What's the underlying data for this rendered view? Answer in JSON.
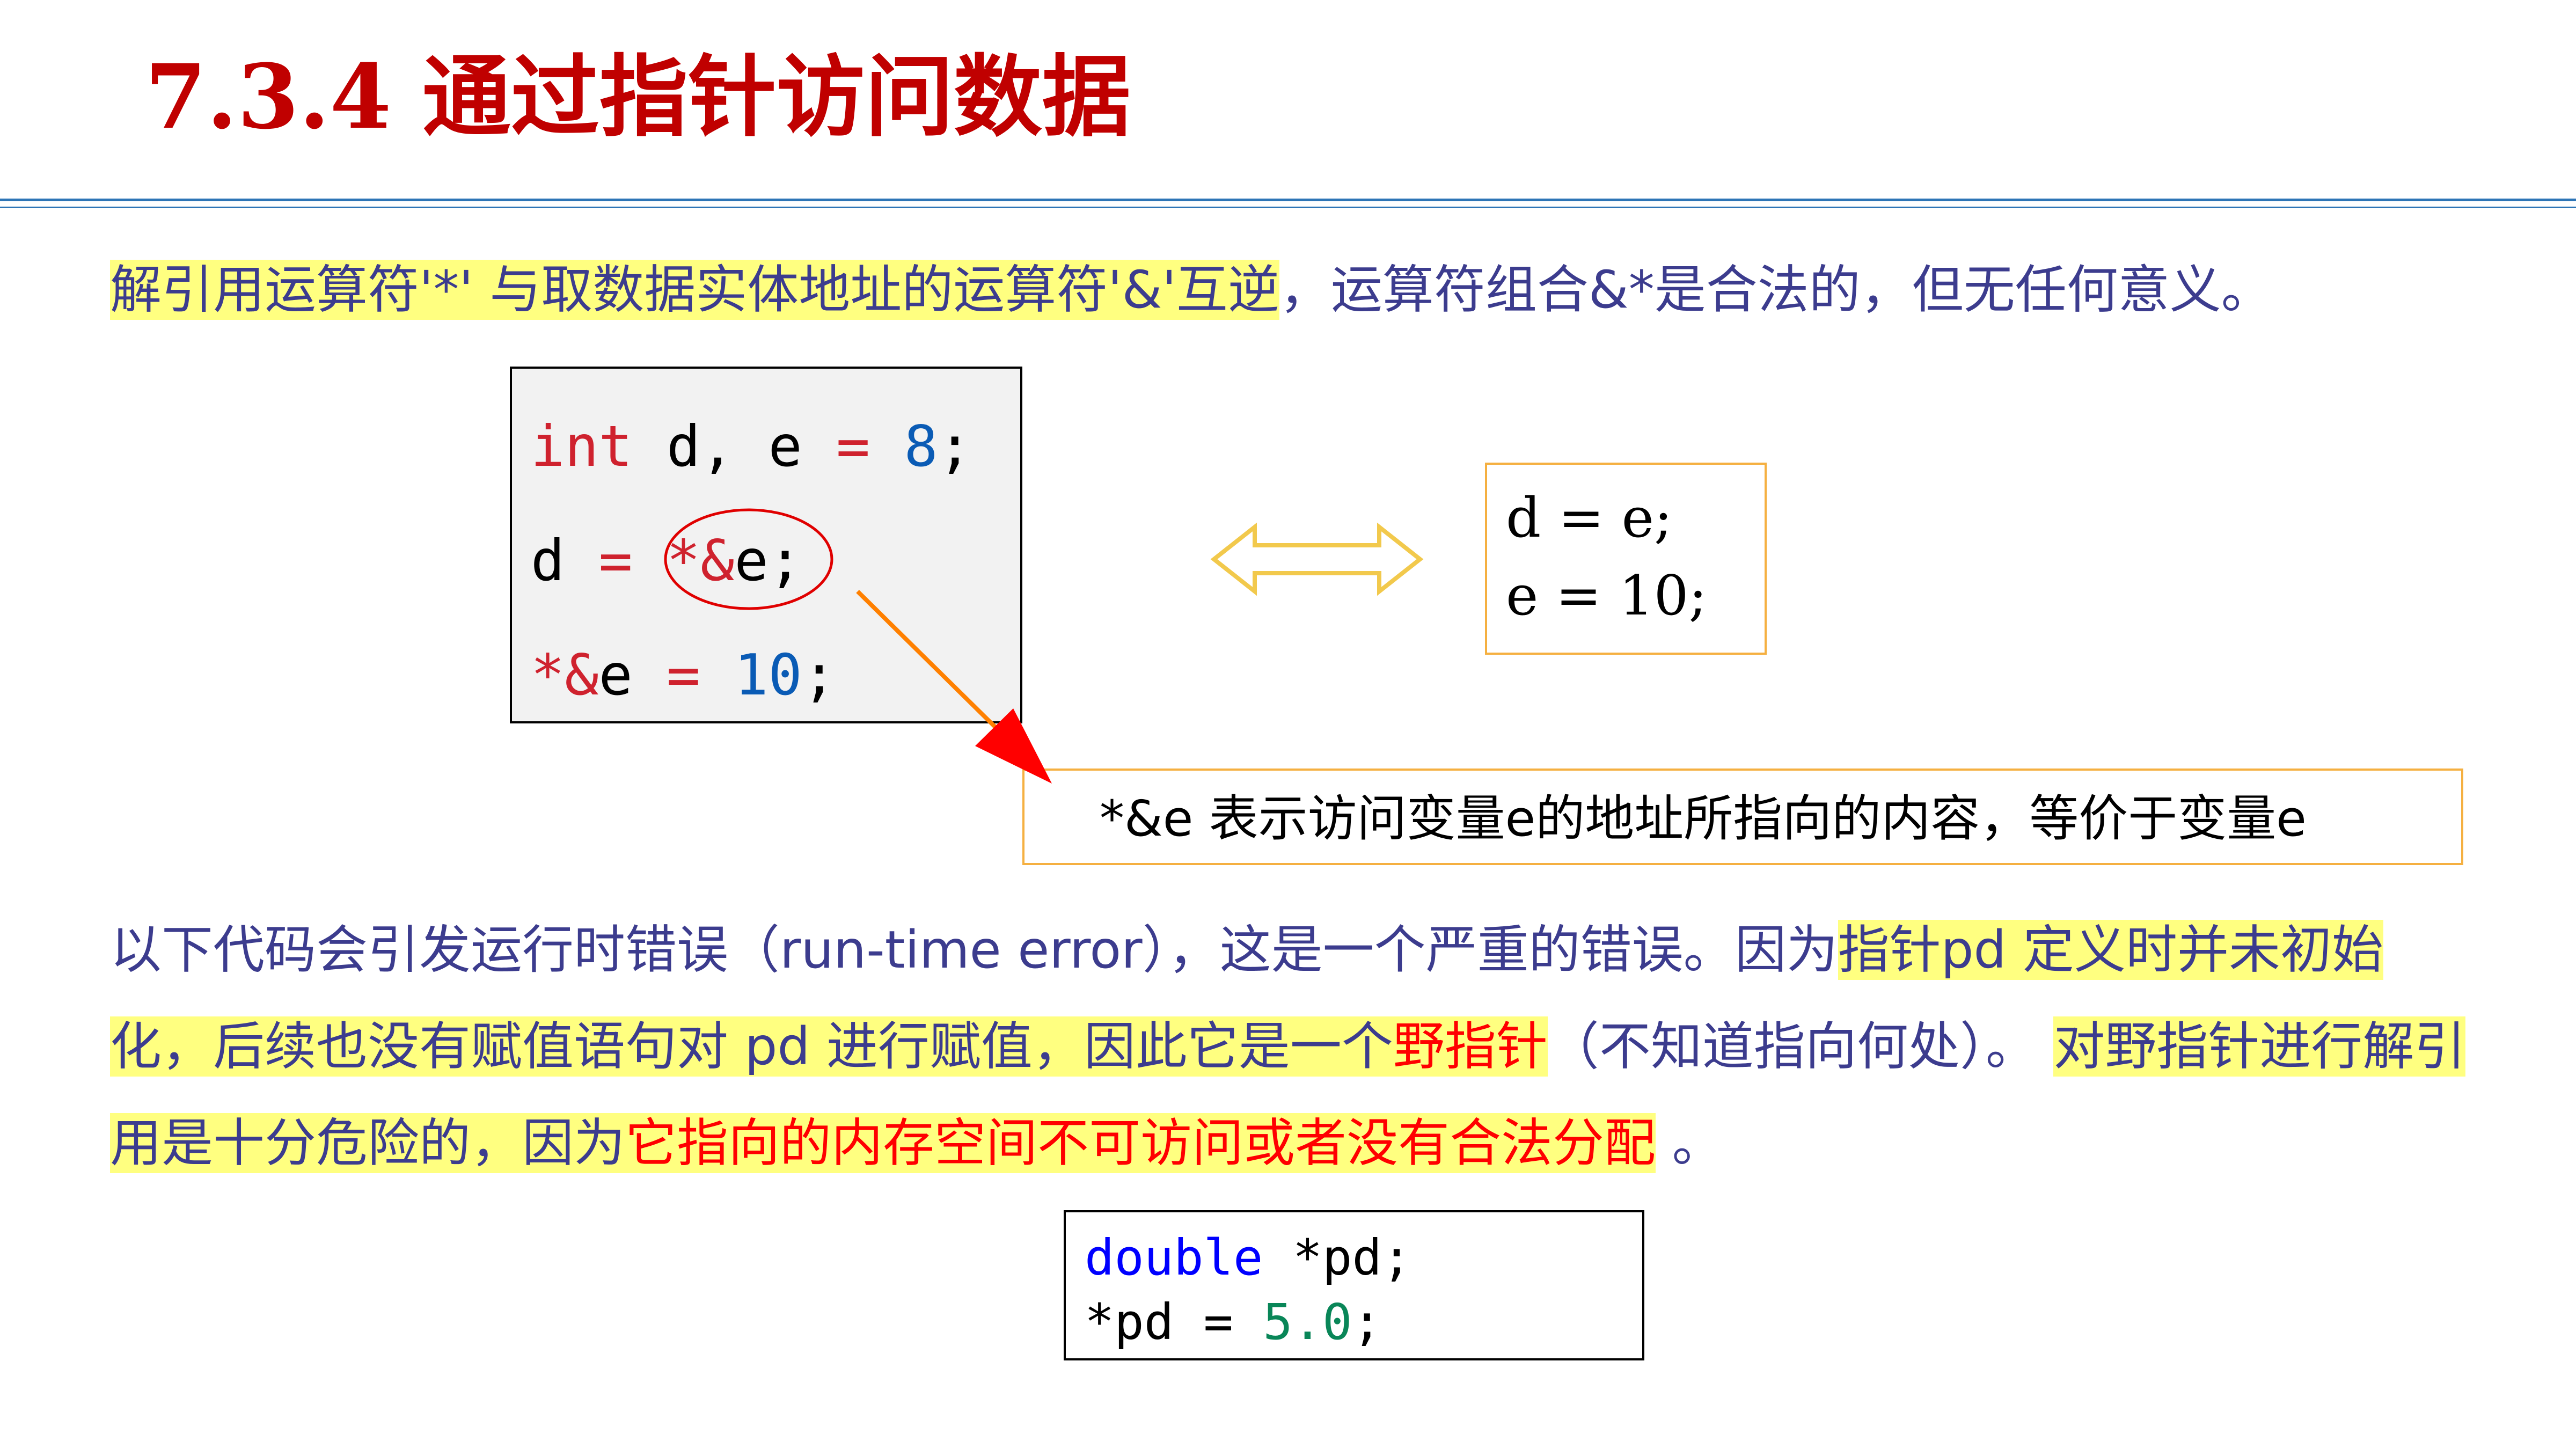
{
  "title": "7.3.4 通过指针访问数据",
  "para1": {
    "hl_text": "解引用运算符'*' 与取数据实体地址的运算符'&'互逆",
    "rest": "，运算符组合&*是合法的，但无任何意义。"
  },
  "code1": {
    "line1": {
      "kw": "int",
      "rest1": " d, e ",
      "op": "=",
      "sp": " ",
      "num": "8",
      "end": ";"
    },
    "line2": {
      "lhs": "d ",
      "op": "=",
      "sp": " ",
      "deref": "*&",
      "var": "e",
      "end": ";"
    },
    "line3": {
      "deref": "*&",
      "var": "e",
      "sp1": " ",
      "op": "=",
      "sp2": " ",
      "num": "10",
      "end": ";"
    }
  },
  "equivalent": {
    "line1": "d = e;",
    "line2": "e = 10;"
  },
  "note": "*&e 表示访问变量e的地址所指向的内容，等价于变量e",
  "para2": {
    "t1": "以下代码会引发运行时错误（run-time error），这是一个严重的错误。因为",
    "h1": "指针pd 定义时并未初始化，后续也没有赋值语句对 pd 进行赋值，因此它是一个",
    "red1": "野指针",
    "t2": "（不知道指向何处）。 ",
    "h2": "对野指针进行解引用是十分危险的，因为",
    "red2": "它指向的内存空间不可访问或者没有合法分配",
    "t3": " 。"
  },
  "code2": {
    "line1": {
      "kw": "double",
      "rest": " *pd;"
    },
    "line2": {
      "pre": "*pd = ",
      "num": "5.0",
      "end": ";"
    }
  },
  "colors": {
    "title": "#c00000",
    "body_text": "#3c3c8e",
    "highlight": "#ffff80",
    "emphasis_red": "#ff0000",
    "box_border_orange": "#f5b041",
    "rule_blue": "#2e75b6"
  }
}
